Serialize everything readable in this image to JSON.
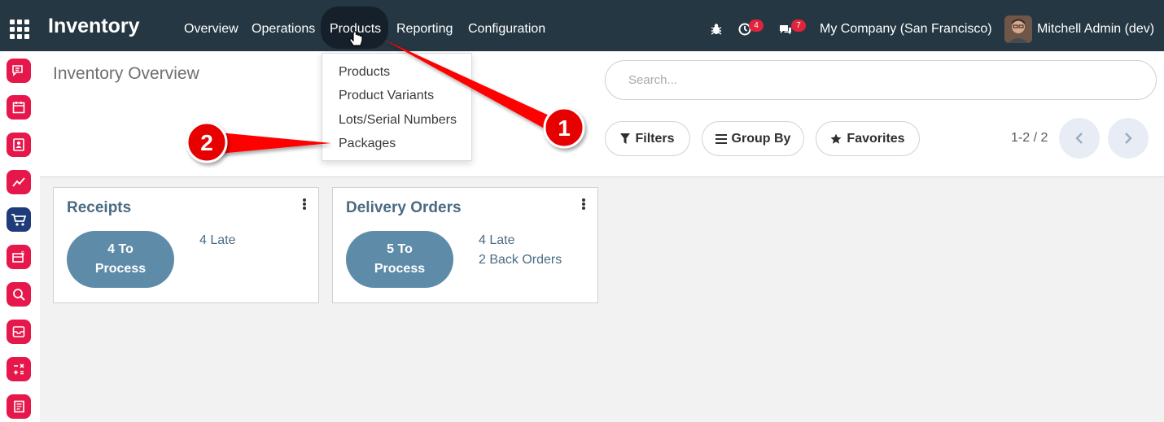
{
  "navbar": {
    "app_title": "Inventory",
    "menu": [
      "Overview",
      "Operations",
      "Products",
      "Reporting",
      "Configuration"
    ],
    "activity_count": "4",
    "messages_count": "7",
    "company": "My Company (San Francisco)",
    "user": "Mitchell Admin (dev)"
  },
  "dropdown": {
    "items": [
      "Products",
      "Product Variants",
      "Lots/Serial Numbers",
      "Packages"
    ]
  },
  "control_panel": {
    "title": "Inventory Overview",
    "search_placeholder": "Search...",
    "filters_label": "Filters",
    "groupby_label": "Group By",
    "favorites_label": "Favorites",
    "pager": "1-2 / 2"
  },
  "cards": [
    {
      "title": "Receipts",
      "process_line1": "4 To",
      "process_line2": "Process",
      "links": [
        "4 Late"
      ]
    },
    {
      "title": "Delivery Orders",
      "process_line1": "5 To",
      "process_line2": "Process",
      "links": [
        "4 Late",
        "2 Back Orders"
      ]
    }
  ],
  "annotations": [
    "1",
    "2"
  ],
  "colors": {
    "navbar": "#243742",
    "accent_red": "#e5174b",
    "card_button": "#5e8ca8",
    "link": "#4a6b84",
    "arrow": "#ff0000"
  },
  "icons": [
    "apps-grid-icon",
    "bug-icon",
    "clock-icon",
    "chat-icon",
    "filter-icon",
    "list-icon",
    "star-icon",
    "chevron-left-icon",
    "chevron-right-icon",
    "kebab-icon"
  ]
}
